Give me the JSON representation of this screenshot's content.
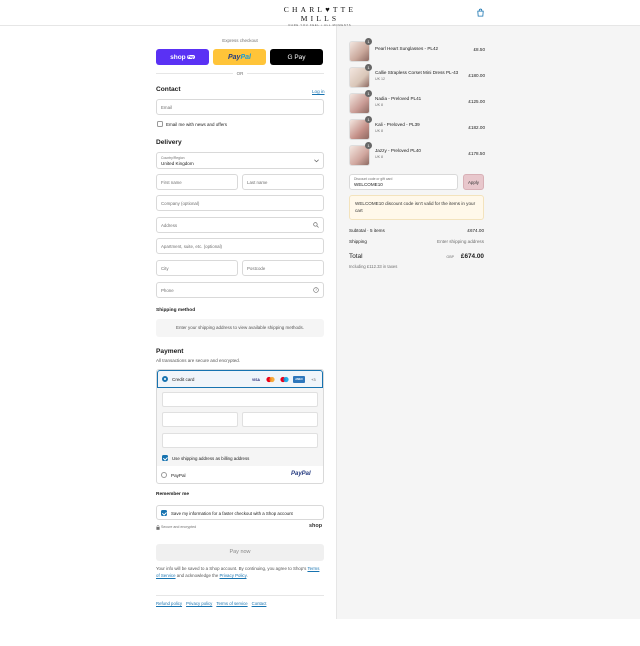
{
  "header": {
    "brand": "CHARL♥TTE MILLS",
    "tagline": "DARE YOU FEEL • ALL MOMENTS",
    "bag_icon": "shopping-bag-icon"
  },
  "express": {
    "label": "Express checkout",
    "shop_pay": "shop",
    "shop_pay_pill": "Pay",
    "paypal_pay": "Pay",
    "paypal_pal": "Pal",
    "gpay": "G Pay",
    "or": "OR"
  },
  "contact": {
    "title": "Contact",
    "login": "Log in",
    "email_placeholder": "Email",
    "news_label": "Email me with news and offers"
  },
  "delivery": {
    "title": "Delivery",
    "country_label": "Country/Region",
    "country_value": "United Kingdom",
    "first_name": "First name",
    "last_name": "Last name",
    "company": "Company (optional)",
    "address": "Address",
    "apartment": "Apartment, suite, etc. (optional)",
    "city": "City",
    "postcode": "Postcode",
    "phone": "Phone"
  },
  "shipping": {
    "title": "Shipping method",
    "message": "Enter your shipping address to view available shipping methods."
  },
  "payment": {
    "title": "Payment",
    "subtitle": "All transactions are secure and encrypted.",
    "credit_card": "Credit card",
    "brands": [
      "VISA",
      "MC",
      "MC",
      "AMEX"
    ],
    "more": "+3",
    "billing_label": "Use shipping address as billing address",
    "paypal_label": "PayPal",
    "paypal_logo": "PayPal"
  },
  "remember": {
    "title": "Remember me",
    "save_label": "Save my information for a faster checkout with a Shop account",
    "secure": "Secure and encrypted",
    "shop": "shop"
  },
  "pay_now": "Pay now",
  "legal": {
    "text": "Your info will be saved to a Shop account. By continuing, you agree to Shop's",
    "terms": "Terms of Service",
    "and": "and acknowledge the",
    "privacy": "Privacy Policy",
    "end": "."
  },
  "footer": [
    "Refund policy",
    "Privacy policy",
    "Terms of service",
    "Contact"
  ],
  "cart": {
    "items": [
      {
        "name": "Pearl Heart Sunglasses - PL42",
        "variant": "",
        "qty": "1",
        "price": "£8.50",
        "color": "#c9a79a"
      },
      {
        "name": "Callie Strapless Corset Mini Dress PL-43",
        "variant": "UK 12",
        "qty": "1",
        "price": "£180.00",
        "color": "#d9c6b8"
      },
      {
        "name": "Nadia - Preloved PL41",
        "variant": "UK 8",
        "qty": "1",
        "price": "£125.00",
        "color": "#c99b94"
      },
      {
        "name": "Kali - Preloved - PL39",
        "variant": "UK 8",
        "qty": "1",
        "price": "£182.00",
        "color": "#c48f87"
      },
      {
        "name": "Jazzy - Preloved PL40",
        "variant": "UK 8",
        "qty": "1",
        "price": "£178.50",
        "color": "#d0a69e"
      }
    ],
    "discount_label": "Discount code or gift card",
    "discount_value": "WELCOME10",
    "apply": "Apply",
    "warning": "WELCOME10 discount code isn't valid for the items in your cart",
    "subtotal_label": "Subtotal · 5 items",
    "subtotal_value": "£674.00",
    "shipping_label": "Shipping",
    "shipping_value": "Enter shipping address",
    "total_label": "Total",
    "currency": "GBP",
    "total_value": "£674.00",
    "taxes": "Including £112.33 in taxes"
  },
  "colors": {
    "accent": "#1773b0",
    "shop_purple": "#5a31f4",
    "paypal_yellow": "#ffc439",
    "apply_pink": "#e8c7cc"
  }
}
